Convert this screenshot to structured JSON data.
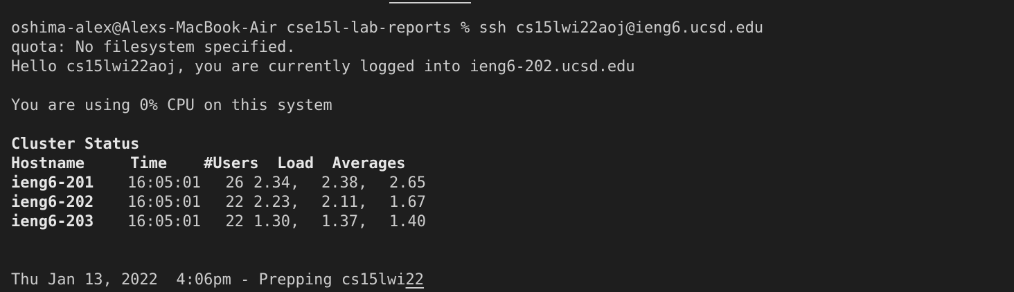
{
  "terminal": {
    "prompt_line": "oshima-alex@Alexs-MacBook-Air cse15l-lab-reports % ssh cs15lwi22aoj@ieng6.ucsd.edu",
    "quota_line": "quota: No filesystem specified.",
    "hello_line": "Hello cs15lwi22aoj, you are currently logged into ieng6-202.ucsd.edu",
    "cpu_line": "You are using 0% CPU on this system",
    "cluster_title": "Cluster Status",
    "header_line": "Hostname     Time    #Users  Load  Averages",
    "cluster_rows": [
      {
        "host": "ieng6-201",
        "time": "16:05:01",
        "users": "26",
        "l1": "2.34,",
        "l2": "2.38,",
        "l3": "2.65"
      },
      {
        "host": "ieng6-202",
        "time": "16:05:01",
        "users": "22",
        "l1": "2.23,",
        "l2": "2.11,",
        "l3": "1.67"
      },
      {
        "host": "ieng6-203",
        "time": "16:05:01",
        "users": "22",
        "l1": "1.30,",
        "l2": "1.37,",
        "l3": "1.40"
      }
    ],
    "prep_prefix": "Thu Jan 13, 2022  4:06pm - Prepping cs15lwi",
    "prep_suffix": "22"
  },
  "colors": {
    "background": "#1e1e1e",
    "text": "#cccccc"
  }
}
